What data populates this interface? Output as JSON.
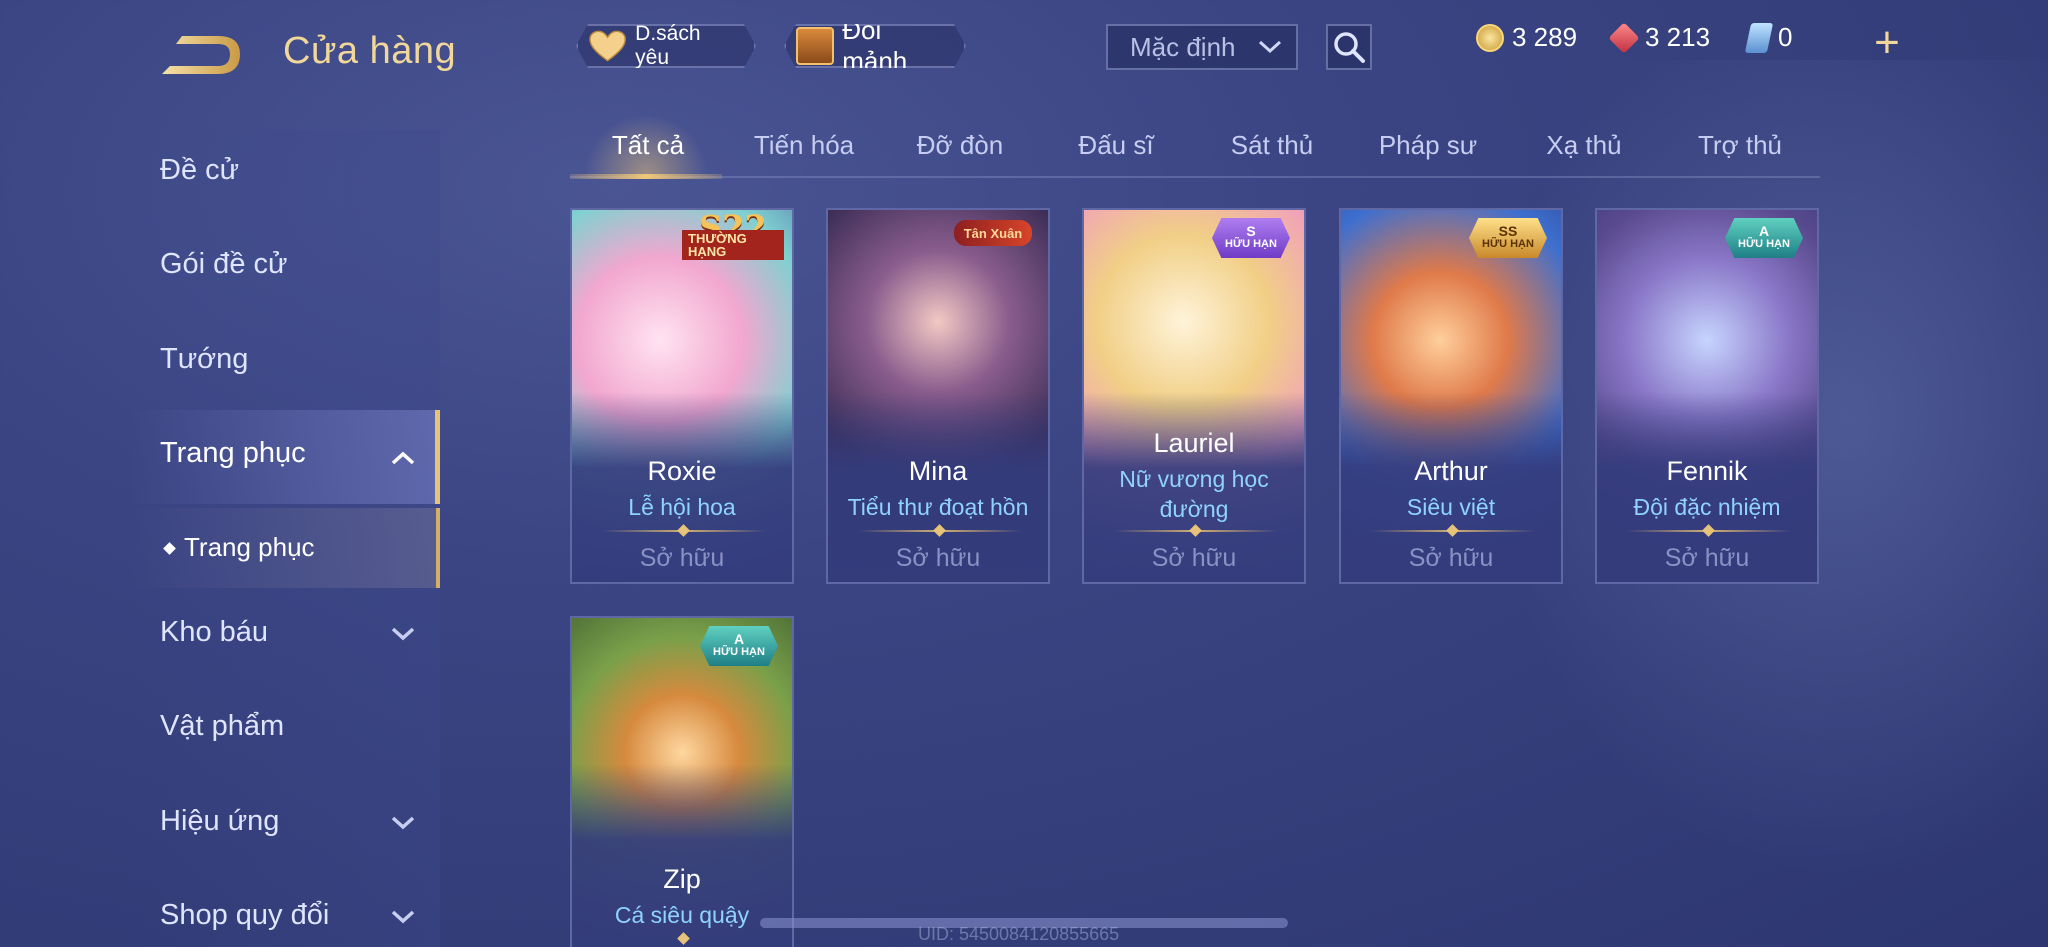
{
  "header": {
    "back_icon": "back-arrow-icon",
    "title": "Cửa hàng",
    "favorites_label": "D.sách yêu",
    "shard_exchange_label": "Đổi mảnh",
    "sort_selected": "Mặc định",
    "search_icon": "search-icon"
  },
  "currencies": {
    "gold": "3 289",
    "rubies": "3 213",
    "tickets": "0",
    "add_label": "+"
  },
  "sidebar": {
    "items": [
      {
        "label": "Đề cử"
      },
      {
        "label": "Gói đề cử"
      },
      {
        "label": "Tướng"
      },
      {
        "label": "Trang phục"
      },
      {
        "label": "Kho báu"
      },
      {
        "label": "Vật phẩm"
      },
      {
        "label": "Hiệu ứng"
      },
      {
        "label": "Shop quy đổi"
      }
    ],
    "sub_item": "Trang phục"
  },
  "tabs": [
    "Tất cả",
    "Tiến hóa",
    "Đỡ đòn",
    "Đấu sĩ",
    "Sát thủ",
    "Pháp sư",
    "Xạ thủ",
    "Trợ thủ"
  ],
  "active_tab": "Tất cả",
  "cards": [
    {
      "name": "Roxie",
      "skin": "Lễ hội hoa",
      "status": "Sở hữu",
      "badge_main": "S22",
      "badge_sub": "THƯỜNG HẠNG",
      "theme": "#d57fae"
    },
    {
      "name": "Mina",
      "skin": "Tiểu thư đoạt hồn",
      "status": "Sở hữu",
      "badge_main": "Tân Xuân",
      "badge_sub": "",
      "theme": "#5b3f6e"
    },
    {
      "name": "Lauriel",
      "skin": "Nữ vương học đường",
      "status": "Sở hữu",
      "badge_main": "S",
      "badge_sub": "HỮU HẠN",
      "theme": "#e0b56a"
    },
    {
      "name": "Arthur",
      "skin": "Siêu việt",
      "status": "Sở hữu",
      "badge_main": "SS",
      "badge_sub": "HỮU HẠN",
      "theme": "#3f6cc7"
    },
    {
      "name": "Fennik",
      "skin": "Đội đặc nhiệm",
      "status": "Sở hữu",
      "badge_main": "A",
      "badge_sub": "HỮU HẠN",
      "theme": "#6d5ba0"
    },
    {
      "name": "Zip",
      "skin": "Cá siêu quậy",
      "status": "",
      "badge_main": "A",
      "badge_sub": "HỮU HẠN",
      "theme": "#7aa04a"
    }
  ],
  "uid_text": "UID: 5450084120855665",
  "colors": {
    "accent_gold": "#f1d79a",
    "skin_blue": "#8fd3ff",
    "status_gray": "#8a92c4"
  }
}
